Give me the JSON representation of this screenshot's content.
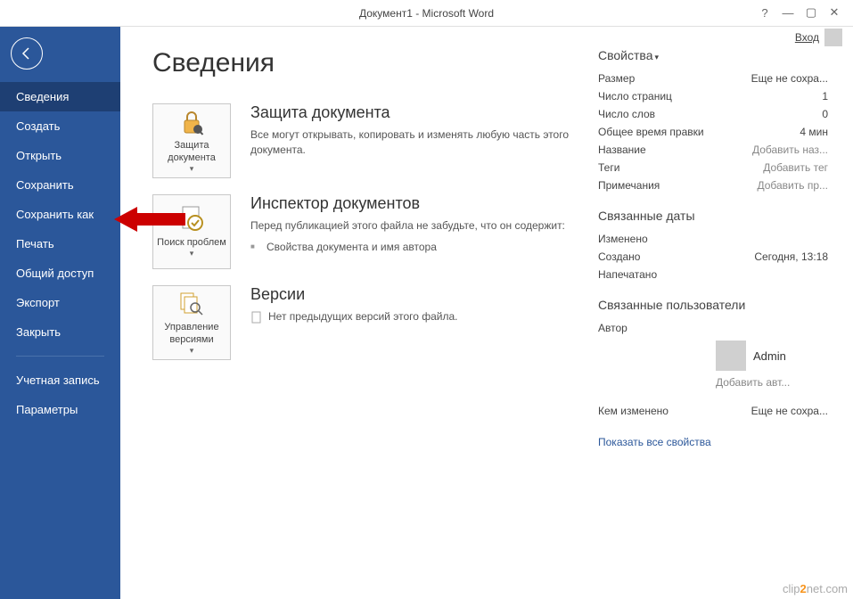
{
  "titlebar": {
    "title": "Документ1 - Microsoft Word"
  },
  "signin": {
    "label": "Вход"
  },
  "nav": {
    "items": [
      {
        "label": "Сведения",
        "selected": true
      },
      {
        "label": "Создать"
      },
      {
        "label": "Открыть"
      },
      {
        "label": "Сохранить"
      },
      {
        "label": "Сохранить как"
      },
      {
        "label": "Печать"
      },
      {
        "label": "Общий доступ"
      },
      {
        "label": "Экспорт"
      },
      {
        "label": "Закрыть"
      }
    ],
    "items2": [
      {
        "label": "Учетная запись"
      },
      {
        "label": "Параметры"
      }
    ]
  },
  "page": {
    "title": "Сведения"
  },
  "sections": {
    "protect": {
      "btn_label": "Защита документа",
      "title": "Защита документа",
      "desc": "Все могут открывать, копировать и изменять любую часть этого документа."
    },
    "inspect": {
      "btn_label": "Поиск проблем",
      "title": "Инспектор документов",
      "desc": "Перед публикацией этого файла не забудьте, что он содержит:",
      "bullet": "Свойства документа и имя автора"
    },
    "versions": {
      "btn_label": "Управление версиями",
      "title": "Версии",
      "desc": "Нет предыдущих версий этого файла."
    }
  },
  "props": {
    "header": "Свойства",
    "rows": {
      "size": {
        "label": "Размер",
        "value": "Еще не сохра..."
      },
      "pages": {
        "label": "Число страниц",
        "value": "1"
      },
      "words": {
        "label": "Число слов",
        "value": "0"
      },
      "edit_time": {
        "label": "Общее время правки",
        "value": "4 мин"
      },
      "title": {
        "label": "Название",
        "value": "Добавить наз..."
      },
      "tags": {
        "label": "Теги",
        "value": "Добавить тег"
      },
      "comments": {
        "label": "Примечания",
        "value": "Добавить пр..."
      }
    },
    "dates_header": "Связанные даты",
    "dates": {
      "modified": {
        "label": "Изменено",
        "value": ""
      },
      "created": {
        "label": "Создано",
        "value": "Сегодня, 13:18"
      },
      "printed": {
        "label": "Напечатано",
        "value": ""
      }
    },
    "users_header": "Связанные пользователи",
    "author_label": "Автор",
    "author_name": "Admin",
    "add_author": "Добавить авт...",
    "last_mod_label": "Кем изменено",
    "last_mod_value": "Еще не сохра...",
    "show_all": "Показать все свойства"
  },
  "watermark": {
    "pre": "clip",
    "mid": "2",
    "post": "net",
    "suffix": ".com"
  }
}
